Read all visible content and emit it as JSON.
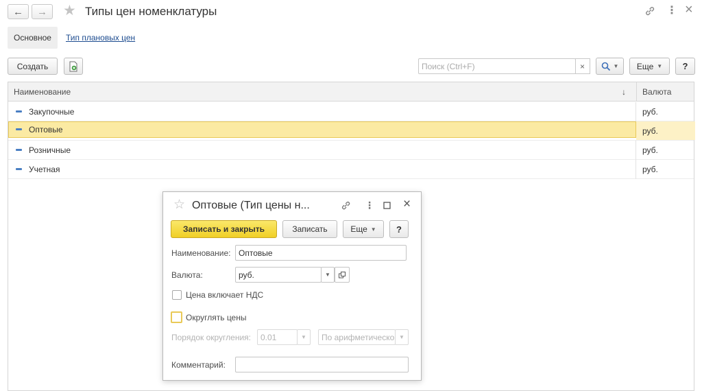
{
  "header": {
    "title": "Типы цен номенклатуры",
    "back_icon": "←",
    "forward_icon": "→",
    "star_icon": "★",
    "link_icon": "🔗",
    "more_icon": "⋮",
    "close_icon": "×"
  },
  "tabs": [
    {
      "label": "Основное"
    },
    {
      "label": "Тип плановых цен"
    }
  ],
  "toolbar": {
    "create_label": "Создать",
    "search_placeholder": "Поиск (Ctrl+F)",
    "clear_icon": "×",
    "search_icon": "🔍",
    "more_label": "Еще",
    "help_label": "?"
  },
  "table": {
    "columns": [
      "Наименование",
      "Валюта"
    ],
    "sort_icon": "↓",
    "rows": [
      {
        "name": "Закупочные",
        "currency": "руб."
      },
      {
        "name": "Оптовые",
        "currency": "руб."
      },
      {
        "name": "Розничные",
        "currency": "руб."
      },
      {
        "name": "Учетная",
        "currency": "руб."
      }
    ],
    "selected_index": 1
  },
  "dialog": {
    "title": "Оптовые (Тип цены н...",
    "save_close_label": "Записать и закрыть",
    "save_label": "Записать",
    "more_label": "Еще",
    "help_label": "?",
    "name_label": "Наименование:",
    "name_value": "Оптовые",
    "currency_label": "Валюта:",
    "currency_value": "руб.",
    "vat_label": "Цена включает НДС",
    "round_label": "Округлять цены",
    "round_order_label": "Порядок округления:",
    "round_order_value": "0.01",
    "round_method_value": "По арифметическо",
    "comment_label": "Комментарий:",
    "comment_value": ""
  },
  "colors": {
    "selection_fill": "#fbeaa3",
    "selection_border": "#e9c957",
    "primary_button": "#f4d73c",
    "link": "#1c4b8f"
  }
}
